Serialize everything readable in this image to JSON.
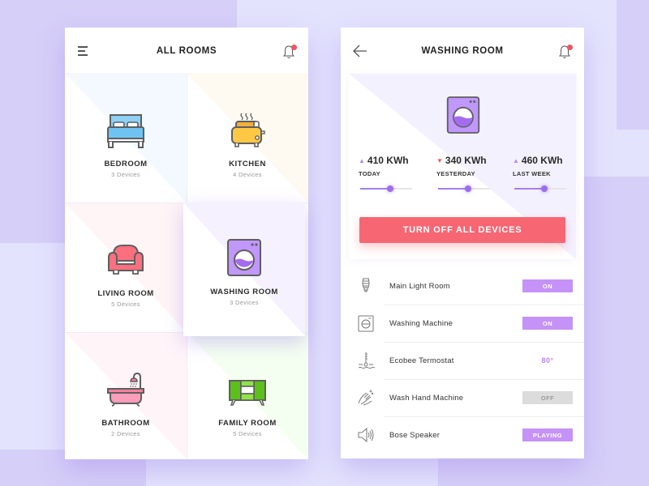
{
  "colors": {
    "accent": "#a67ef0",
    "danger": "#f76673",
    "toggle_on": "#c592f7",
    "toggle_off": "#dcdcdc"
  },
  "left_screen": {
    "title": "ALL ROOMS",
    "menu_icon": "hamburger-icon",
    "notification_icon": "bell-icon",
    "rooms": [
      {
        "name": "BEDROOM",
        "devices": "3 Devices",
        "icon": "bed-icon"
      },
      {
        "name": "KITCHEN",
        "devices": "4 Devices",
        "icon": "toaster-icon"
      },
      {
        "name": "LIVING ROOM",
        "devices": "5 Devices",
        "icon": "armchair-icon"
      },
      {
        "name": "WASHING ROOM",
        "devices": "3 Devices",
        "icon": "washing-machine-icon",
        "selected": true
      },
      {
        "name": "BATHROOM",
        "devices": "2 Devices",
        "icon": "bathtub-icon"
      },
      {
        "name": "FAMILY ROOM",
        "devices": "5 Devices",
        "icon": "tv-cabinet-icon"
      }
    ]
  },
  "right_screen": {
    "title": "WASHING ROOM",
    "back_icon": "back-arrow-icon",
    "notification_icon": "bell-icon",
    "stats": [
      {
        "value": "410 KWh",
        "label": "TODAY",
        "trend": "up",
        "slider_fraction": 0.58
      },
      {
        "value": "340 KWh",
        "label": "YESTERDAY",
        "trend": "down",
        "slider_fraction": 0.58
      },
      {
        "value": "460 KWh",
        "label": "LAST WEEK",
        "trend": "up",
        "slider_fraction": 0.58
      }
    ],
    "turn_off_button": "TURN OFF ALL DEVICES",
    "devices": [
      {
        "name": "Main Light Room",
        "control": "ON",
        "state": "on",
        "icon": "light-bulb-icon"
      },
      {
        "name": "Washing Machine",
        "control": "ON",
        "state": "on",
        "icon": "washing-machine-icon"
      },
      {
        "name": "Ecobee Termostat",
        "control": "80°",
        "state": "text",
        "icon": "thermometer-icon"
      },
      {
        "name": "Wash Hand Machine",
        "control": "OFF",
        "state": "off",
        "icon": "hand-wash-icon"
      },
      {
        "name": "Bose Speaker",
        "control": "PLAYING",
        "state": "on",
        "icon": "speaker-icon"
      }
    ]
  }
}
